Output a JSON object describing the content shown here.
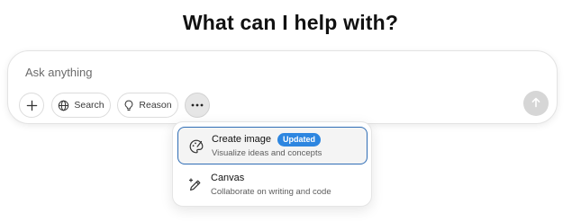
{
  "heading": "What can I help with?",
  "composer": {
    "placeholder": "Ask anything",
    "tools": {
      "add_icon": "plus-icon",
      "search_label": "Search",
      "search_icon": "globe-icon",
      "reason_label": "Reason",
      "reason_icon": "lightbulb-icon",
      "more_icon": "ellipsis-icon",
      "send_icon": "arrow-up-icon"
    }
  },
  "tools_menu": {
    "items": [
      {
        "title": "Create image",
        "badge": "Updated",
        "subtitle": "Visualize ideas and concepts",
        "icon": "palette-icon",
        "highlighted": true
      },
      {
        "title": "Canvas",
        "subtitle": "Collaborate on writing and code",
        "icon": "pen-sparkle-icon",
        "highlighted": false
      }
    ]
  },
  "colors": {
    "badge": "#2d86e0",
    "highlight_border": "#2f6db5",
    "send_disabled": "#d6d6d6"
  }
}
